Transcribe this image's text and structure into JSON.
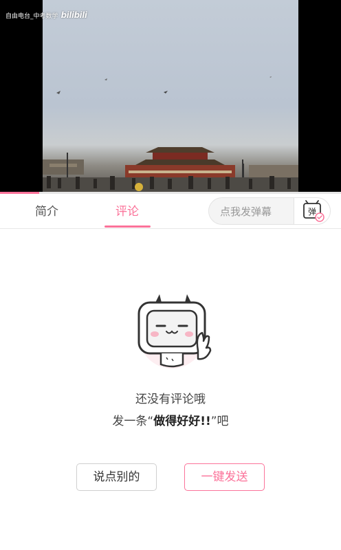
{
  "video": {
    "watermark_text": "自由电台_中考数学",
    "watermark_logo": "bilibili",
    "progress": 0.115
  },
  "tabs": [
    {
      "label": "简介",
      "active": false
    },
    {
      "label": "评论",
      "active": true
    }
  ],
  "danmaku": {
    "placeholder": "点我发弹幕",
    "button_label": "弹"
  },
  "empty_state": {
    "line1": "还没有评论哦",
    "line2_prefix": "发一条“",
    "line2_emphasis": "做得好好!!",
    "line2_suffix": "”吧"
  },
  "actions": {
    "other_label": "说点别的",
    "send_label": "一键发送"
  },
  "colors": {
    "accent": "#fb7299",
    "video_bg": "#000000"
  }
}
